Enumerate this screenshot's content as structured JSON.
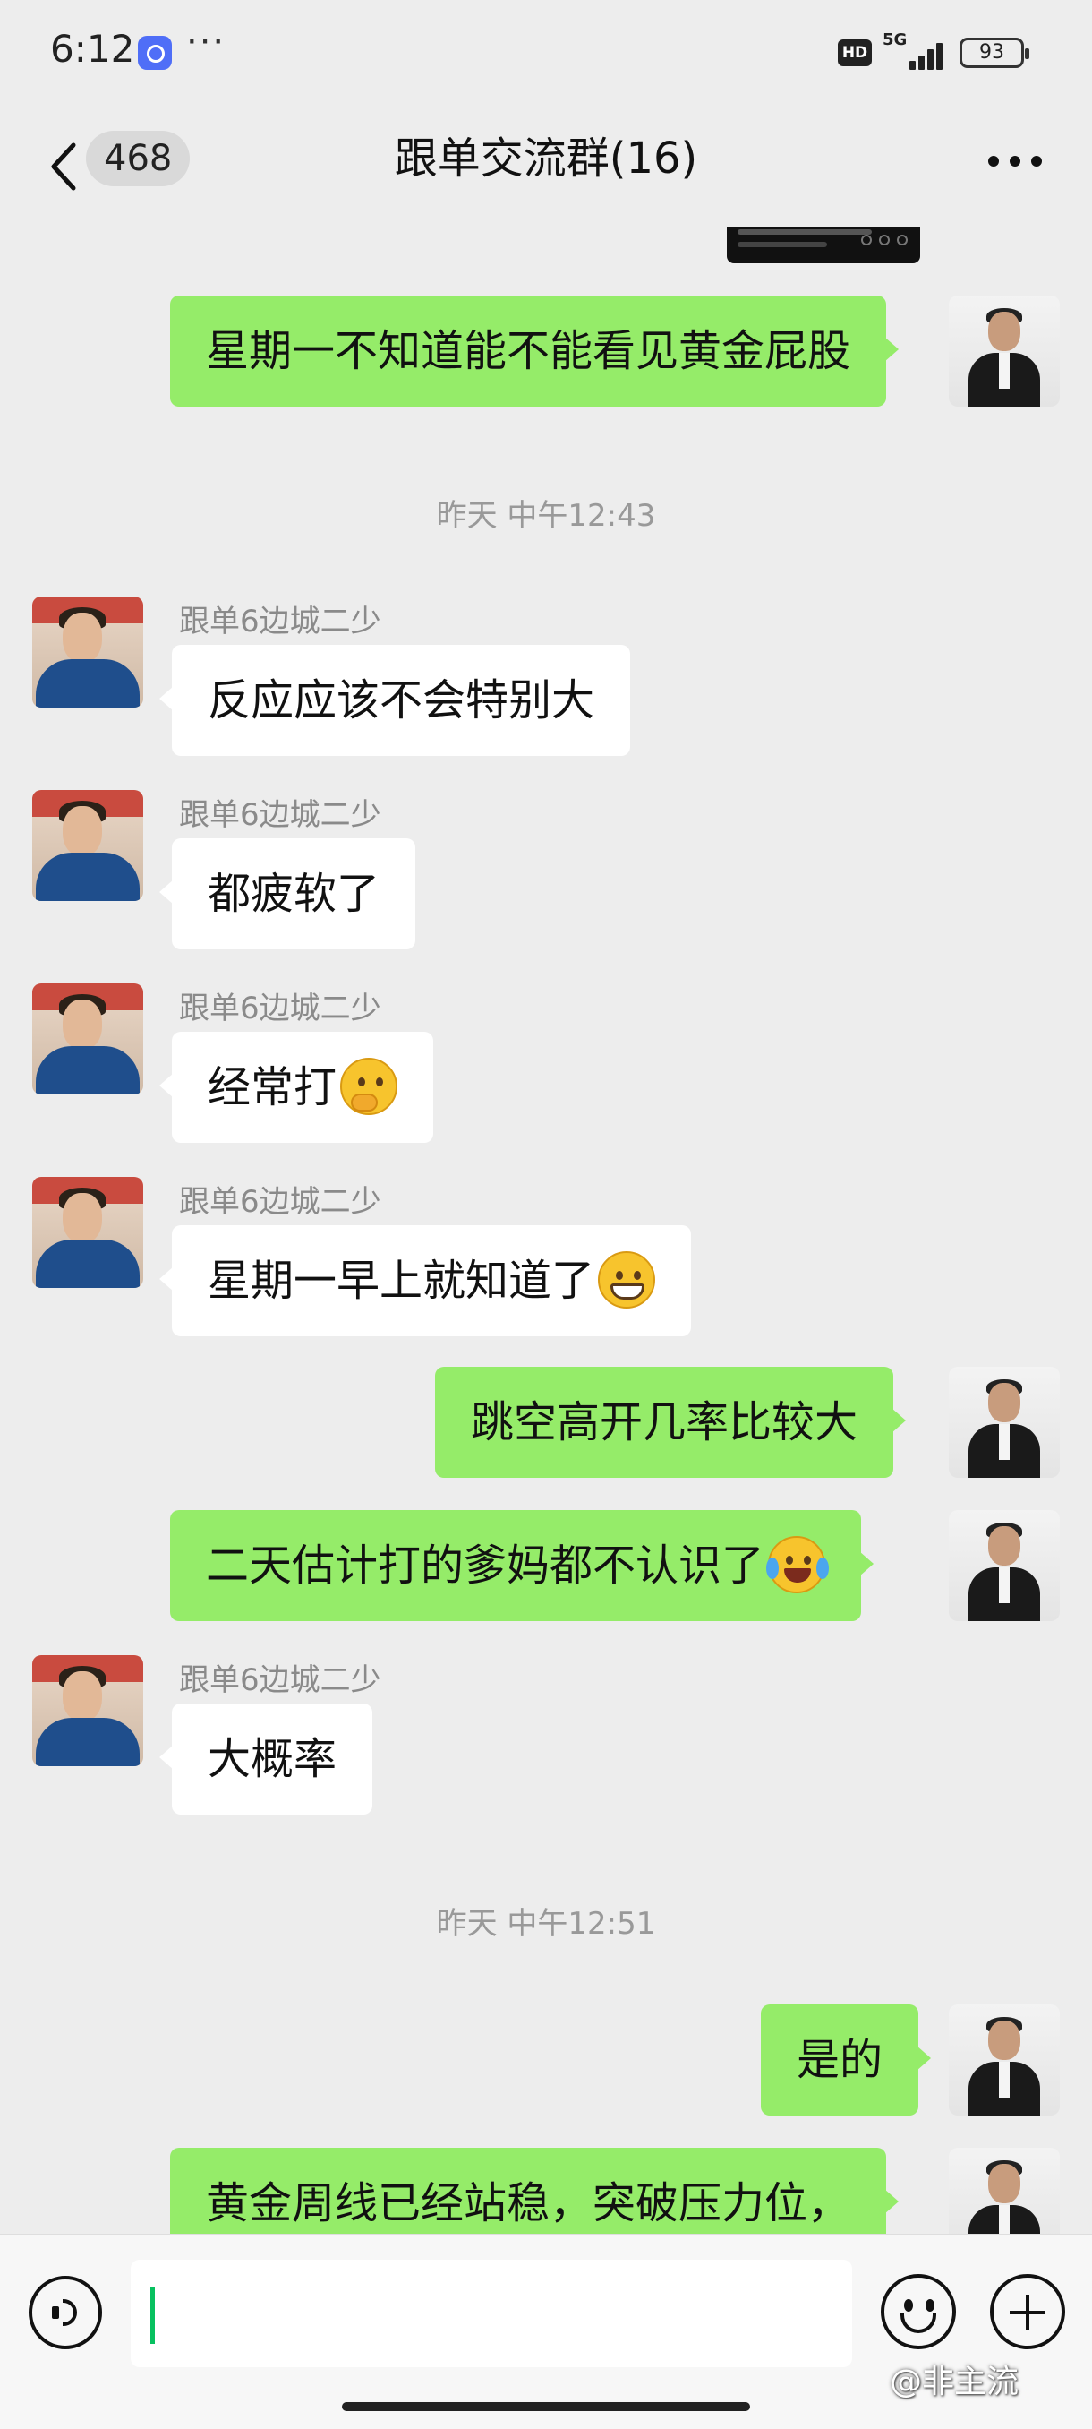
{
  "status_bar": {
    "time": "6:12",
    "dots": "···",
    "hd_label": "HD",
    "network": "5G",
    "battery": "93"
  },
  "nav": {
    "back_label": "back",
    "unread_count": "468",
    "title": "跟单交流群(16)"
  },
  "messages": [
    {
      "side": "self",
      "text": "星期一不知道能不能看见黄金屁股"
    },
    {
      "type": "time",
      "text": "昨天 中午12:43"
    },
    {
      "side": "other",
      "sender": "跟单6边城二少",
      "text": "反应应该不会特别大"
    },
    {
      "side": "other",
      "sender": "跟单6边城二少",
      "text": "都疲软了"
    },
    {
      "side": "other",
      "sender": "跟单6边城二少",
      "text": "经常打",
      "emoji": "thinking-face"
    },
    {
      "side": "other",
      "sender": "跟单6边城二少",
      "text": "星期一早上就知道了",
      "emoji": "grinning-face"
    },
    {
      "side": "self",
      "text": "跳空高开几率比较大"
    },
    {
      "side": "self",
      "text": "二天估计打的爹妈都不认识了",
      "emoji": "laughing-crying-face"
    },
    {
      "side": "other",
      "sender": "跟单6边城二少",
      "text": "大概率"
    },
    {
      "type": "time",
      "text": "昨天 中午12:51"
    },
    {
      "side": "self",
      "text": "是的"
    },
    {
      "side": "self",
      "text": "黄金周线已经站稳，突破压力位，"
    }
  ],
  "input_bar": {
    "voice_icon": "voice-icon",
    "emoji_icon": "smiley-icon",
    "plus_icon": "plus-icon",
    "input_value": ""
  },
  "watermark": "@非主流",
  "colors": {
    "background": "#ededed",
    "self_bubble": "#95ec69",
    "other_bubble": "#ffffff",
    "accent": "#07c160"
  }
}
